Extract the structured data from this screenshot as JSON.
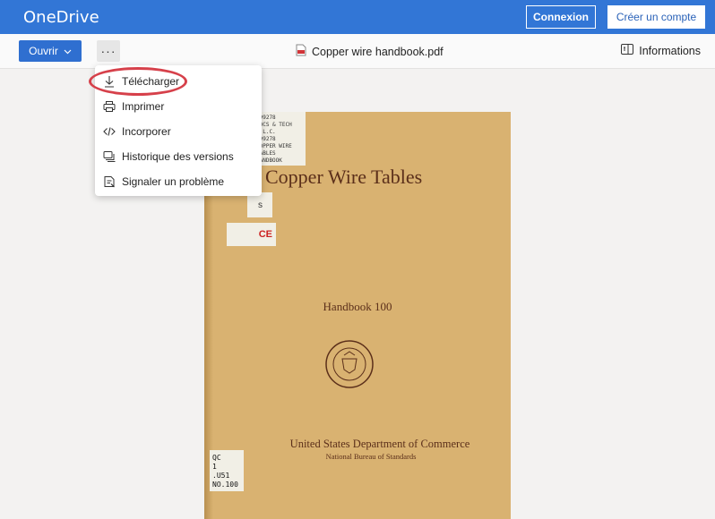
{
  "header": {
    "brand": "OneDrive",
    "connexion": "Connexion",
    "create_account": "Créer un compte"
  },
  "toolbar": {
    "open_label": "Ouvrir",
    "more_label": "···",
    "file_name": "Copper wire handbook.pdf",
    "info_label": "Informations"
  },
  "menu": {
    "items": [
      {
        "label": "Télécharger",
        "icon": "download-icon"
      },
      {
        "label": "Imprimer",
        "icon": "print-icon"
      },
      {
        "label": "Incorporer",
        "icon": "embed-icon"
      },
      {
        "label": "Historique des versions",
        "icon": "version-history-icon"
      },
      {
        "label": "Signaler un problème",
        "icon": "report-icon"
      }
    ]
  },
  "document": {
    "sticker_code": "199278",
    "sticker_lines": [
      "199278",
      "DOCS & TECH R.L.C.",
      "199278",
      "COPPER WIRE TABLES",
      "HANDBOOK"
    ],
    "title": "Copper Wire Tables",
    "sticker2": "s",
    "sticker3": "CE",
    "subtitle": "Handbook 100",
    "department": "United States Department of Commerce",
    "bureau": "National Bureau of Standards",
    "call_number": [
      "QC",
      "1",
      ".U51",
      "NO.100"
    ]
  },
  "colors": {
    "header_bg": "#3276d6",
    "primary_button": "#2f6fd0",
    "highlight_circle": "#d6404a",
    "cover": "#d9b271"
  }
}
